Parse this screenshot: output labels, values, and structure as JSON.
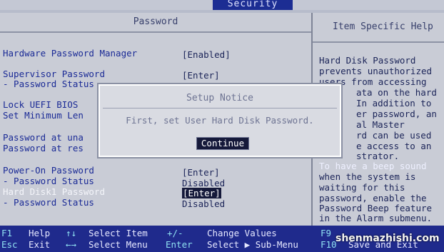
{
  "top_tab": "Security",
  "left_panel": {
    "header": "Password",
    "rows": [
      {
        "label": "Hardware Password Manager",
        "value": "[Enabled]"
      },
      {
        "label": "Supervisor Password",
        "value": "[Enter]"
      },
      {
        "label": " - Password Status",
        "value": ""
      },
      {
        "label": "Lock UEFI BIOS",
        "value": ""
      },
      {
        "label": "Set Minimum Len",
        "value": ""
      },
      {
        "label": "Password at una",
        "value": ""
      },
      {
        "label": "Password at res",
        "value": ""
      },
      {
        "label": "Power-On Password",
        "value": "[Enter]"
      },
      {
        "label": " - Password Status",
        "value": "Disabled"
      },
      {
        "label": "Hard Disk1 Password",
        "value": "[Enter]"
      },
      {
        "label": " - Password Status",
        "value": "Disabled"
      }
    ]
  },
  "right_panel": {
    "header": "Item Specific Help",
    "help_lines": [
      "Hard Disk Password",
      "prevents unauthorized",
      "users from accessing",
      "ata on the hard",
      "In addition to",
      "er password, an",
      "al Master",
      "rd can be used",
      "e access to an",
      "strator.",
      "To have a beep sound",
      "when the system is",
      "waiting for this",
      "password, enable the",
      "Password Beep feature",
      "in the Alarm submenu."
    ]
  },
  "dialog": {
    "title": "Setup Notice",
    "message": "First, set User Hard Disk Password.",
    "button": "Continue"
  },
  "footer": {
    "r1": [
      {
        "key": "F1",
        "text": "Help"
      },
      {
        "key": "↑↓",
        "text": "Select Item"
      },
      {
        "key": "+/-",
        "text": "Change Values"
      },
      {
        "key": "F9",
        "text": ""
      }
    ],
    "r2": [
      {
        "key": "Esc",
        "text": "Exit"
      },
      {
        "key": "←→",
        "text": "Select Menu"
      },
      {
        "key": "Enter",
        "text": "Select ▶ Sub-Menu"
      },
      {
        "key": "F10",
        "text": "Save and Exit"
      }
    ]
  },
  "watermark": "shenmazhishi.com",
  "colors": {
    "footer_bg": "#1f2a8c",
    "panel_bg": "#c9ccd6",
    "label_blue": "#1a2a96"
  }
}
